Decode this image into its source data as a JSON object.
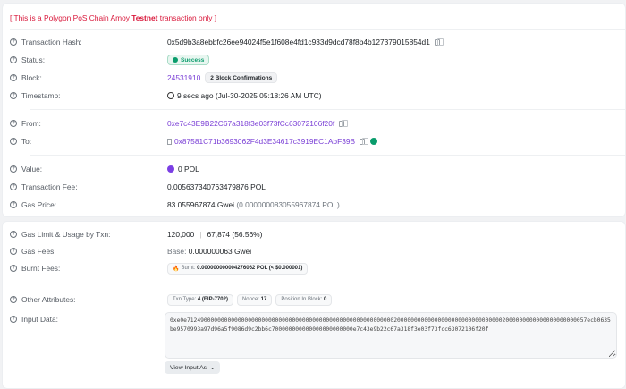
{
  "banner": {
    "prefix": "[ This is a Polygon PoS Chain Amoy ",
    "bold": "Testnet",
    "suffix": " transaction only ]"
  },
  "rows": {
    "hash": {
      "label": "Transaction Hash:",
      "value": "0x5d9b3a8ebbfc26ee94024f5e1f608e4fd1c933d9dcd78f8b4b127379015854d1"
    },
    "status": {
      "label": "Status:",
      "value": "Success"
    },
    "block": {
      "label": "Block:",
      "value": "24531910",
      "confirmations": "2 Block Confirmations"
    },
    "timestamp": {
      "label": "Timestamp:",
      "value": "9 secs ago (Jul-30-2025 05:18:26 AM UTC)"
    },
    "from": {
      "label": "From:",
      "value": "0xe7c43E9B22C67a318f3e03f73fCc63072106f20f"
    },
    "to": {
      "label": "To:",
      "value": "0x87581C71b3693062F4d3E34617c3919EC1AbF39B"
    },
    "value": {
      "label": "Value:",
      "value": "0 POL"
    },
    "fee": {
      "label": "Transaction Fee:",
      "value": "0.005637340763479876 POL"
    },
    "gas_price": {
      "label": "Gas Price:",
      "value": "83.055967874 Gwei",
      "secondary": "(0.000000083055967874 POL)"
    },
    "gas_limit": {
      "label": "Gas Limit & Usage by Txn:",
      "limit": "120,000",
      "sep": "|",
      "usage": "67,874 (56.56%)"
    },
    "gas_fees": {
      "label": "Gas Fees:",
      "base_label": "Base:",
      "base": "0.000000063 Gwei"
    },
    "burnt": {
      "label": "Burnt Fees:",
      "badge_label": "Burnt:",
      "value": "0.000000000004276062 POL (< $0.000001)"
    },
    "other": {
      "label": "Other Attributes:",
      "txn_type_label": "Txn Type:",
      "txn_type": "4 (EIP-7702)",
      "nonce_label": "Nonce:",
      "nonce": "17",
      "position_label": "Position In Block:",
      "position": "0"
    },
    "input": {
      "label": "Input Data:",
      "value": "0xe0e7124900000000000000000000000000000000000000000000000000000000200000000000000000000000000000002000000000000000000000057ecb0635be9570993a97d96a5f9086d9c2bb6c700000000000000000000000e7c43e9b22c67a318f3e03f73fcc63072106f20f",
      "view_button": "View Input As"
    }
  },
  "colors": {
    "link": "#7a3fd6",
    "success": "#0a9c6c",
    "banner": "#d9183b"
  }
}
